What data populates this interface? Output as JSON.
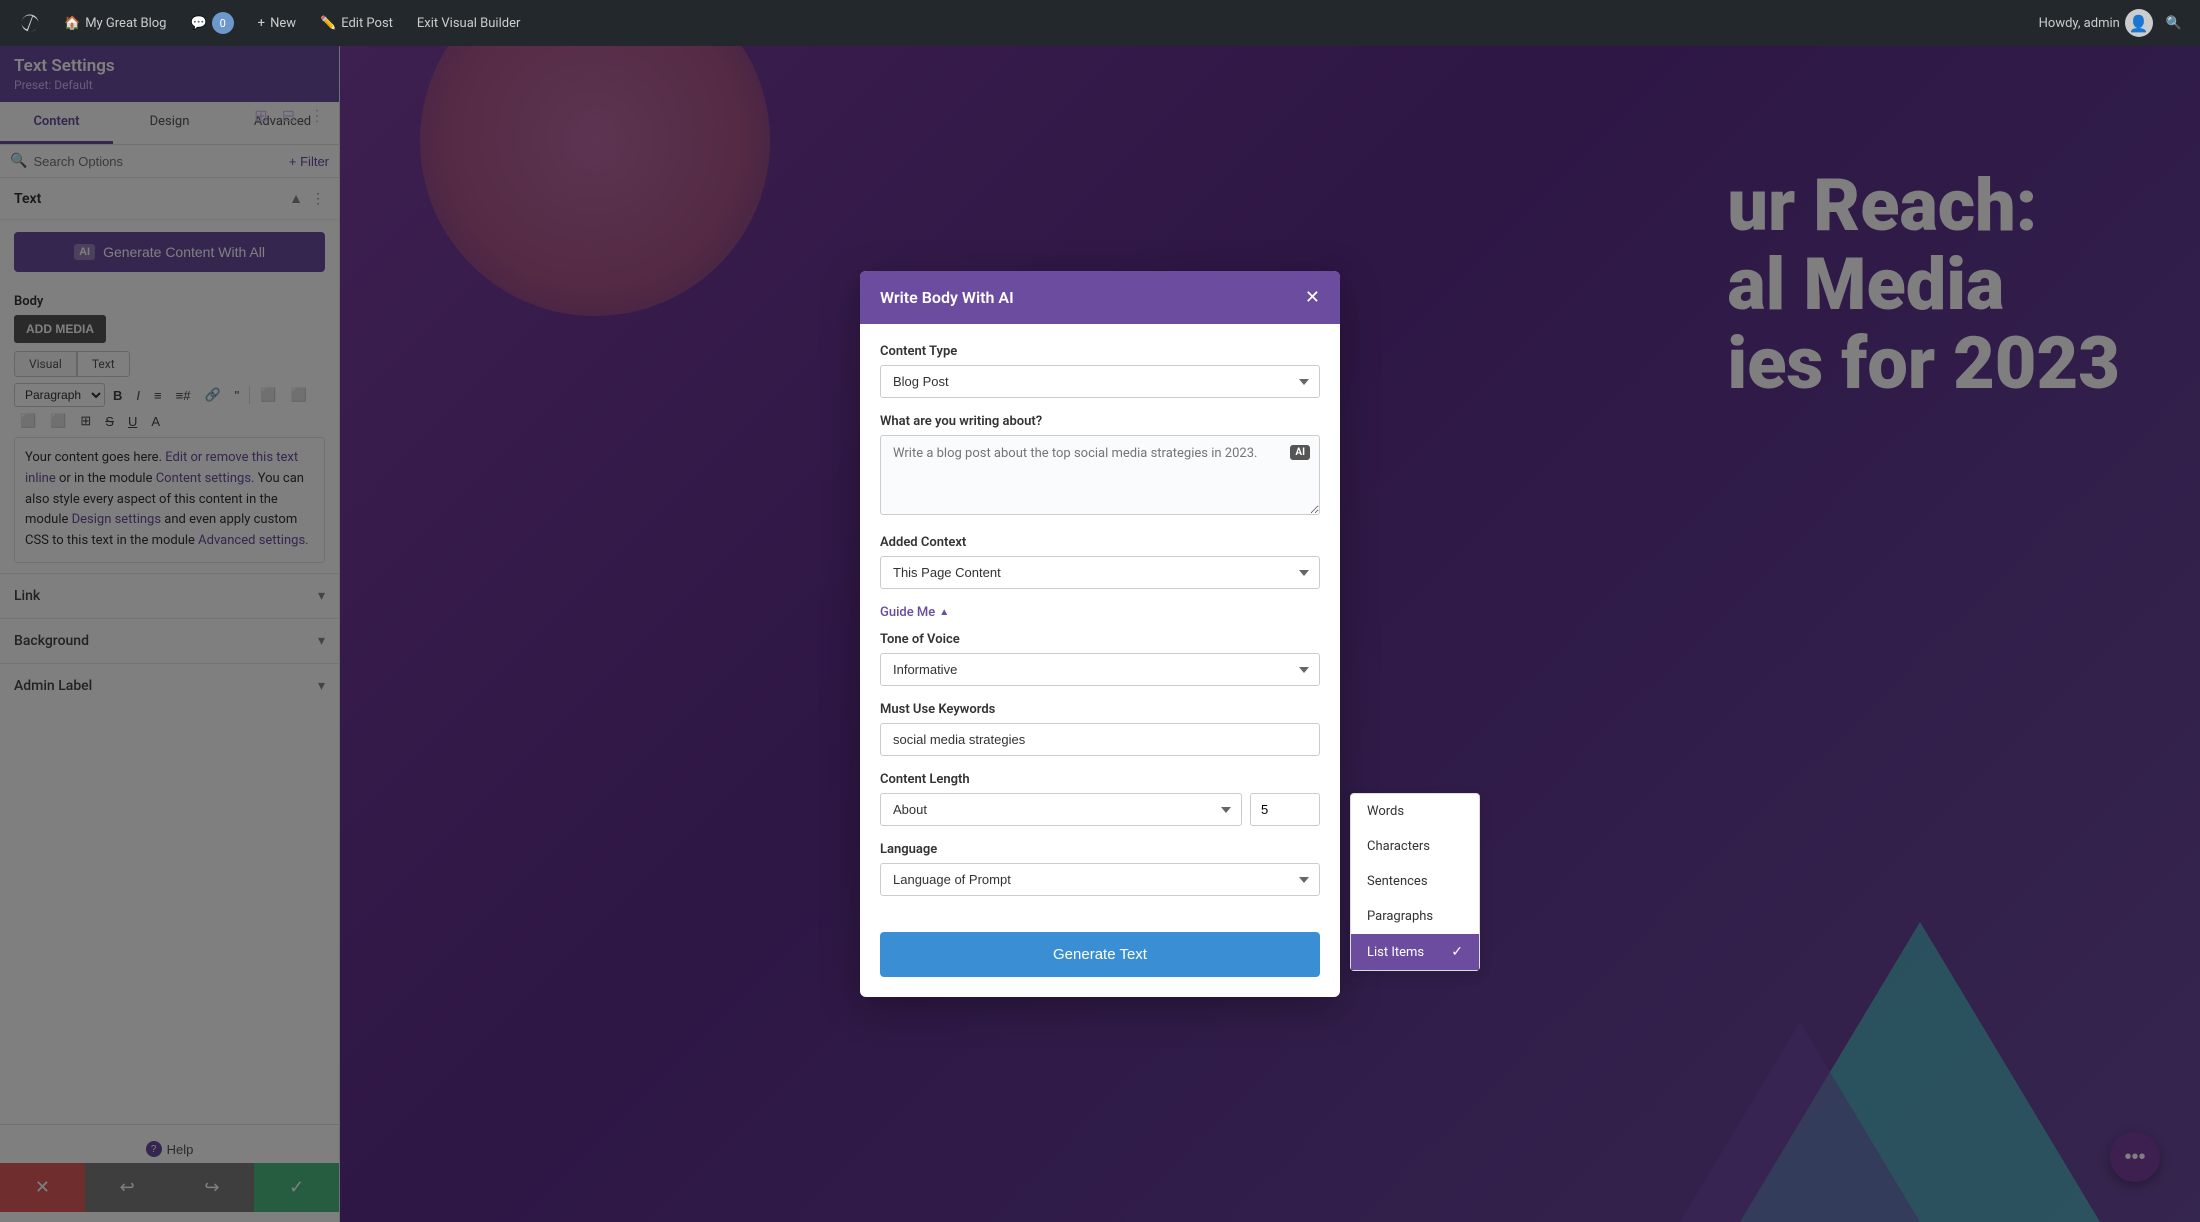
{
  "wpbar": {
    "blog_name": "My Great Blog",
    "comment_count": "0",
    "new_label": "New",
    "edit_post_label": "Edit Post",
    "exit_builder_label": "Exit Visual Builder",
    "admin_label": "Howdy, admin"
  },
  "sidebar": {
    "title": "Text Settings",
    "preset": "Preset: Default",
    "tabs": [
      "Content",
      "Design",
      "Advanced"
    ],
    "active_tab": "Content",
    "search_placeholder": "Search Options",
    "filter_label": "+ Filter",
    "text_section_label": "Text",
    "generate_btn_label": "Generate Content With All",
    "ai_badge": "AI",
    "body_label": "Body",
    "add_media_label": "ADD MEDIA",
    "editor_tabs": [
      "Visual",
      "Text"
    ],
    "paragraph_select": "Paragraph",
    "editor_text": "Your content goes here. Edit or remove this text inline or in the module Content settings. You can also style every aspect of this content in the module Design settings and even apply custom CSS to this text in the module Advanced settings.",
    "link_label": "Link",
    "background_label": "Background",
    "admin_label_label": "Admin Label",
    "help_label": "Help"
  },
  "modal": {
    "title": "Write Body With AI",
    "content_type_label": "Content Type",
    "content_type_value": "Blog Post",
    "writing_about_label": "What are you writing about?",
    "writing_about_placeholder": "Write a blog post about the top social media strategies in 2023.",
    "added_context_label": "Added Context",
    "added_context_value": "This Page Content",
    "guide_me_label": "Guide Me",
    "tone_label": "Tone of Voice",
    "tone_value": "Informative",
    "keywords_label": "Must Use Keywords",
    "keywords_value": "social media strategies",
    "content_length_label": "Content Length",
    "content_length_about": "About",
    "content_length_num": "5",
    "language_label": "Language",
    "language_value": "Language of Prompt",
    "generate_text_btn": "Generate Text",
    "dropdown_options": [
      "Words",
      "Characters",
      "Sentences",
      "Paragraphs",
      "List Items"
    ],
    "selected_option": "List Items"
  },
  "hero": {
    "text_line1": "ur Reach:",
    "text_line2": "al Media",
    "text_line3": "ies for 2023"
  }
}
